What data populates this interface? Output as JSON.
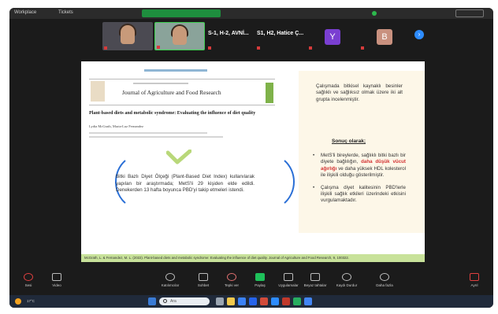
{
  "window": {
    "workspace_label": "Workplace",
    "tickets_label": "Tickets"
  },
  "participants": [
    {
      "name": "",
      "type": "video"
    },
    {
      "name": "",
      "type": "video"
    },
    {
      "name": "",
      "type": "text",
      "big": "S-1, H-2, AVNİ..."
    },
    {
      "name": "",
      "type": "text",
      "big": "S1, H2, Hatice Ç..."
    },
    {
      "name": "",
      "type": "avatar",
      "letter": "Y",
      "color": "#7a3fd1"
    },
    {
      "name": "",
      "type": "avatar",
      "letter": "B",
      "color": "#c9917f"
    }
  ],
  "slide": {
    "journal_title": "Journal of Agriculture and Food Research",
    "paper_title": "Plant-based diets and metabolic syndrome: Evaluating the influence of diet quality",
    "authors": "Lydia McGrath, Maria-Luz Fernandez",
    "summary": "Bitki Bazlı Diyet Ölçeği (Plant-Based Diet Index) kullanılarak yapılan bir araştırmada; MetS'li 29 kişiden elde edildi. Denekerden 13 hafta boyunca PBD'yi takip etmeleri istendi.",
    "right_paragraph": "Çalışmada bitkisel kaynaklı besinler sağlıklı ve sağlıksız olmak üzere iki alt grupta incelenmiştir.",
    "conclusion_heading": "Sonuç olarak;",
    "bullet1_pre": "MetS'li bireylerde, sağlıklı bitki bazlı bir diyete bağlılığın,",
    "bullet1_bold": "daha düşük vücut ağırlığı",
    "bullet1_post": "ve daha yüksek HDL kolesterol ile ilişkili olduğu gösterilmiştir.",
    "bullet2": "Çalışma diyet kalitesinin PBD'lerle ilişkili sağlık etkileri üzerindeki etkisini vurgulamaktadır.",
    "citation": "McGrath, L. & Fernandez, M. L. (2022). Plant-based diets and metabolic syndrome: Evaluating the influence of diet quality. Journal of Agriculture and Food Research, 9, 100322."
  },
  "toolbar": {
    "mute": "Sesi",
    "video": "Video",
    "participants": "Katılımcılar",
    "chat": "Sohbet",
    "react": "Tepki ver",
    "share": "Paylaş",
    "apps": "Uygulamalar",
    "whiteboards": "Beyaz tahtalar",
    "notes": "Notlar",
    "record": "Kaydı Durdur",
    "more": "Daha fazla",
    "leave": "Ayrıl"
  },
  "taskbar": {
    "weather": "17°C",
    "search_placeholder": "Ara",
    "tray_text": ""
  },
  "colors": {
    "accent_green": "#1ec15a",
    "accent_blue": "#2d8cff",
    "cite_bar": "#c8e29a",
    "highlight_red": "#d23232"
  }
}
